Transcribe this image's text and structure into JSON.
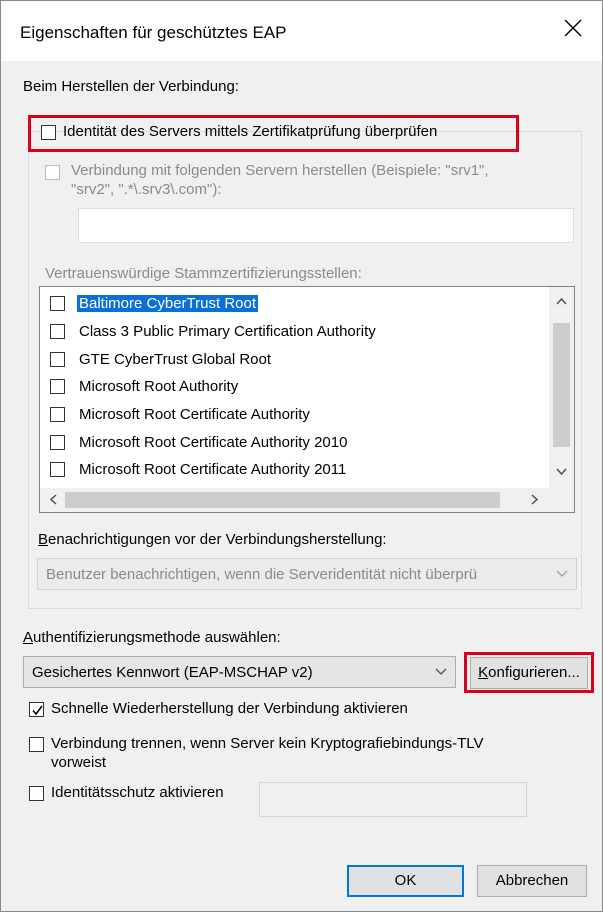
{
  "dialog": {
    "title": "Eigenschaften für geschütztes EAP",
    "section_label": "Beim Herstellen der Verbindung:",
    "verify_server": {
      "label": "Identität des Servers mittels Zertifikatprüfung überprüfen",
      "checked": false
    },
    "connect_servers": {
      "label_line1": "Verbindung mit folgenden Servern herstellen (Beispiele: \"srv1\",",
      "label_line2": "\"srv2\", \".*\\.srv3\\.com\"):",
      "checked": false,
      "value": ""
    },
    "trusted_ca_label": "Vertrauenswürdige Stammzertifizierungsstellen:",
    "ca_list": [
      {
        "label": "Baltimore CyberTrust Root",
        "checked": false,
        "selected": true
      },
      {
        "label": "Class 3 Public Primary Certification Authority",
        "checked": false,
        "selected": false
      },
      {
        "label": "GTE CyberTrust Global Root",
        "checked": false,
        "selected": false
      },
      {
        "label": "Microsoft Root Authority",
        "checked": false,
        "selected": false
      },
      {
        "label": "Microsoft Root Certificate Authority",
        "checked": false,
        "selected": false
      },
      {
        "label": "Microsoft Root Certificate Authority 2010",
        "checked": false,
        "selected": false
      },
      {
        "label": "Microsoft Root Certificate Authority 2011",
        "checked": false,
        "selected": false
      }
    ],
    "notify_label": "Benachrichtigungen vor der Verbindungsherstellung:",
    "notify_value": "Benutzer benachrichtigen, wenn die Serveridentität nicht überprü",
    "auth_label": "Authentifizierungsmethode auswählen:",
    "auth_value": "Gesichertes Kennwort (EAP-MSCHAP v2)",
    "configure_label": "Konfigurieren...",
    "fast_reconnect": {
      "label": "Schnelle Wiederherstellung der Verbindung aktivieren",
      "checked": true
    },
    "disconnect": {
      "label_line1": "Verbindung trennen, wenn Server kein Kryptografiebindungs-TLV",
      "label_line2": "vorweist",
      "checked": false
    },
    "identity_privacy": {
      "label": "Identitätsschutz aktivieren",
      "checked": false,
      "value": ""
    },
    "ok_label": "OK",
    "cancel_label": "Abbrechen"
  },
  "colors": {
    "highlight_red": "#d9001b",
    "selection_blue": "#0a6fd6",
    "default_button_border": "#0078d7"
  },
  "icons": [
    "close-icon",
    "checkmark-icon",
    "chevron-down-icon",
    "scroll-up-icon",
    "scroll-down-icon",
    "scroll-left-icon",
    "scroll-right-icon"
  ]
}
